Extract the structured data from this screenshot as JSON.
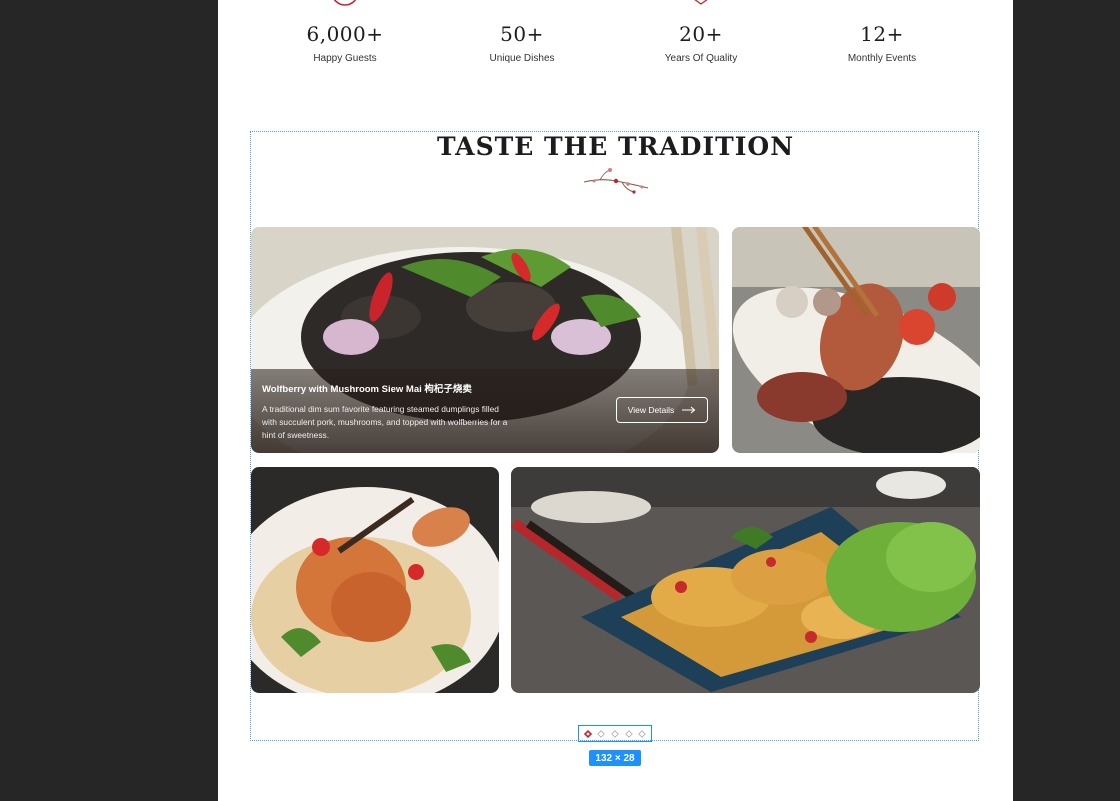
{
  "stats": [
    {
      "value": "6,000+",
      "label": "Happy Guests",
      "icon": "smile-circle-icon"
    },
    {
      "value": "50+",
      "label": "Unique Dishes",
      "icon": "dish-stack-icon"
    },
    {
      "value": "20+",
      "label": "Years Of Quality",
      "icon": "award-star-icon"
    },
    {
      "value": "12+",
      "label": "Monthly Events",
      "icon": "calendar-star-icon"
    }
  ],
  "section": {
    "title": "TASTE THE TRADITION",
    "ornament": "plum-blossom-branch-icon"
  },
  "featured": {
    "name": "Wolfberry with Mushroom Siew Mai 枸杞子烧卖",
    "description": "A traditional dim sum favorite featuring steamed dumplings filled with succulent pork, mushrooms, and topped with wolfberries for a hint of sweetness.",
    "button_label": "View Details",
    "button_icon": "arrow-right-icon"
  },
  "carousel": {
    "count": 5,
    "active": 0
  },
  "inspector_badge": "132 × 28",
  "colors": {
    "accent": "#c0272d",
    "background": "#262626",
    "inspector": "#1e90ff"
  }
}
